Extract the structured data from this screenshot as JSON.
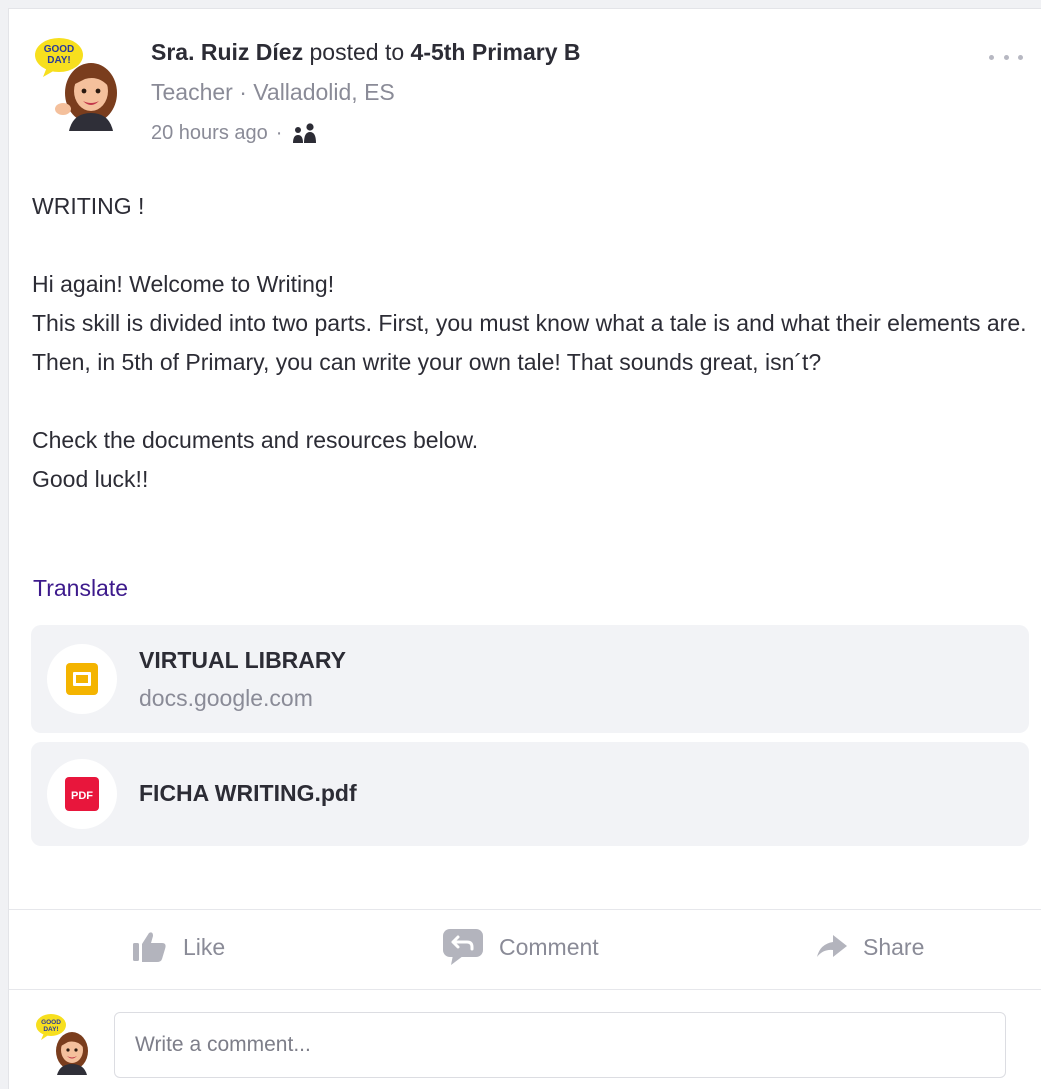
{
  "post": {
    "author": "Sra. Ruiz Díez",
    "posted_to_text": "posted to",
    "group": "4-5th Primary B",
    "subtitle": "Teacher · Valladolid, ES",
    "time": "20 hours ago",
    "meta_separator": "·",
    "body": "WRITING !\n\nHi again! Welcome to Writing!\nThis skill is divided into two parts. First, you must know what a tale is and what their elements are. Then, in 5th of Primary, you can write your own tale! That sounds great, isn´t?\n\nCheck the documents and resources below.\nGood luck!!",
    "translate_label": "Translate",
    "avatar_badge": "GOOD DAY!"
  },
  "attachments": [
    {
      "title": "VIRTUAL LIBRARY",
      "domain": "docs.google.com",
      "icon": "google-slides-icon",
      "color": "#f4b400"
    },
    {
      "title": "FICHA WRITING.pdf",
      "icon": "pdf-icon",
      "icon_text": "PDF",
      "color": "#e8163c"
    }
  ],
  "actions": {
    "like": "Like",
    "comment": "Comment",
    "share": "Share"
  },
  "comment_box": {
    "placeholder": "Write a comment..."
  },
  "colors": {
    "translate_link": "#3d1a8c",
    "muted_text": "#8a8b97",
    "text": "#2c2c35"
  }
}
